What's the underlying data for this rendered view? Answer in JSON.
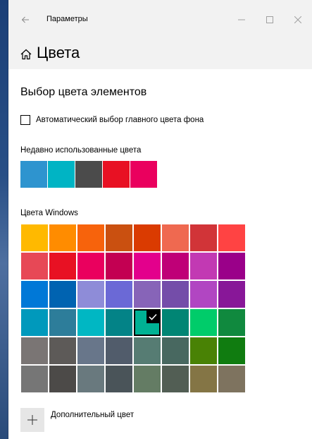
{
  "window": {
    "title": "Параметры",
    "controls": [
      "minimize",
      "maximize",
      "close"
    ]
  },
  "header": {
    "page_title": "Цвета"
  },
  "main": {
    "section_title": "Выбор цвета элементов",
    "auto_color_checkbox": {
      "label": "Автоматический выбор главного цвета фона",
      "checked": false
    },
    "recent_label": "Недавно использованные цвета",
    "recent_colors": [
      "#2e94cf",
      "#00b4c4",
      "#4b4b4b",
      "#e81123",
      "#ea005e"
    ],
    "windows_colors_label": "Цвета Windows",
    "windows_colors": [
      [
        "#ffb900",
        "#ff8c00",
        "#f7630c",
        "#ca5010",
        "#da3b01",
        "#ef6950",
        "#d13438",
        "#ff4343"
      ],
      [
        "#e74856",
        "#e81123",
        "#ea005e",
        "#c30052",
        "#e3008c",
        "#bf0077",
        "#c239b3",
        "#9a0089"
      ],
      [
        "#0078d7",
        "#0063b1",
        "#8e8cd8",
        "#6b69d6",
        "#8764b8",
        "#744da9",
        "#b146c2",
        "#881798"
      ],
      [
        "#0099bc",
        "#2d7d9a",
        "#00b7c3",
        "#038387",
        "#00b294",
        "#018574",
        "#00cc6a",
        "#10893e"
      ],
      [
        "#7a7574",
        "#5d5a58",
        "#68768a",
        "#515c6b",
        "#567c73",
        "#486860",
        "#498205",
        "#107c10"
      ],
      [
        "#767676",
        "#4c4a48",
        "#69797e",
        "#4a5459",
        "#647c64",
        "#525e54",
        "#847545",
        "#7e735f"
      ]
    ],
    "selected_color": {
      "row": 3,
      "col": 4,
      "hex": "#00b294"
    },
    "custom_color_label": "Дополнительный цвет"
  }
}
